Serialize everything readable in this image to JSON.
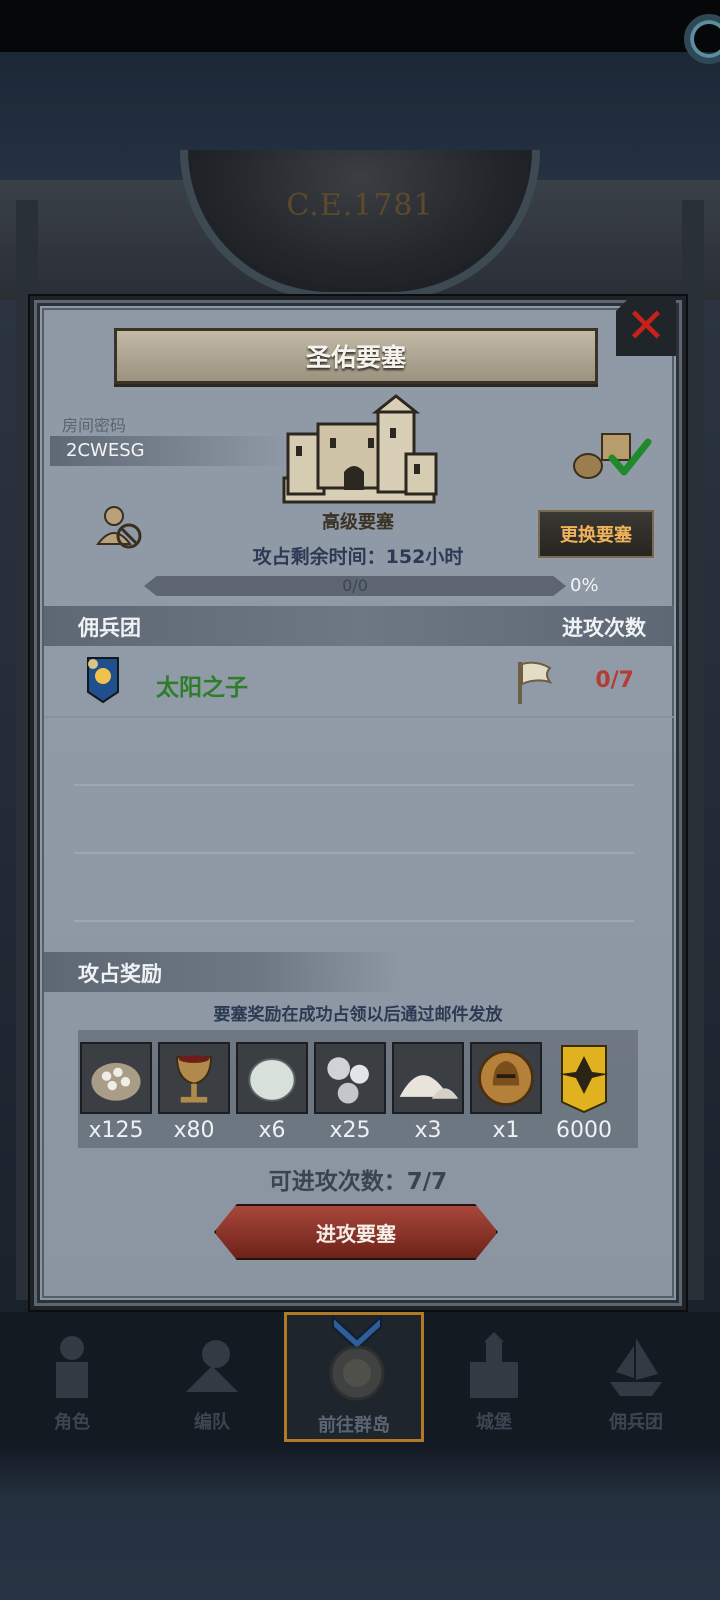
{
  "background": {
    "era_year": "C.E.1781"
  },
  "dialog": {
    "title": "圣佑要塞",
    "room_label": "房间密码",
    "room_code": "2CWESG",
    "fortress_grade": "高级要塞",
    "time_label": "攻占剩余时间：152小时",
    "change_button": "更换要塞",
    "progress_text": "0/0",
    "progress_percent": "0%",
    "progress_value": 0,
    "mercenary_header": "佣兵团",
    "attack_count_header": "进攻次数",
    "mercenaries": [
      {
        "name": "太阳之子",
        "attacks": "0/7"
      }
    ],
    "reward_header": "攻占奖励",
    "reward_note": "要塞奖励在成功占领以后通过邮件发放",
    "rewards": [
      {
        "icon": "sack-icon",
        "qty": "x125"
      },
      {
        "icon": "goblet-icon",
        "qty": "x80"
      },
      {
        "icon": "stone-icon",
        "qty": "x6"
      },
      {
        "icon": "silver-icon",
        "qty": "x25"
      },
      {
        "icon": "salt-icon",
        "qty": "x3"
      },
      {
        "icon": "helmet-medal-icon",
        "qty": "x1"
      },
      {
        "icon": "rank-badge-icon",
        "qty": "6000"
      }
    ],
    "attacks_remaining": "可进攻次数：7/7",
    "attack_button": "进攻要塞"
  },
  "nav": [
    {
      "label": "角色",
      "icon": "knight-icon"
    },
    {
      "label": "编队",
      "icon": "formation-icon"
    },
    {
      "label": "前往群岛",
      "icon": "compass-icon",
      "active": true
    },
    {
      "label": "城堡",
      "icon": "castle-icon"
    },
    {
      "label": "佣兵团",
      "icon": "ship-icon"
    }
  ],
  "colors": {
    "panel": "#8f99a5",
    "merc_name": "#2f7d2a",
    "attack_count": "#b33c34",
    "change_button_text": "#f0b35c",
    "attack_button": "#8d2f25",
    "close_x": "#c8211a"
  }
}
